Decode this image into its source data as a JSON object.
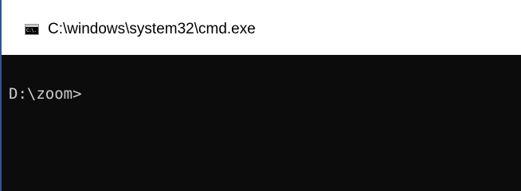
{
  "window": {
    "title": "C:\\windows\\system32\\cmd.exe",
    "icon": "cmd-console-icon",
    "icon_text": "C:\\."
  },
  "console": {
    "prompt": "D:\\zoom>",
    "background_color": "#0c0c0c",
    "text_color": "#cccccc"
  }
}
